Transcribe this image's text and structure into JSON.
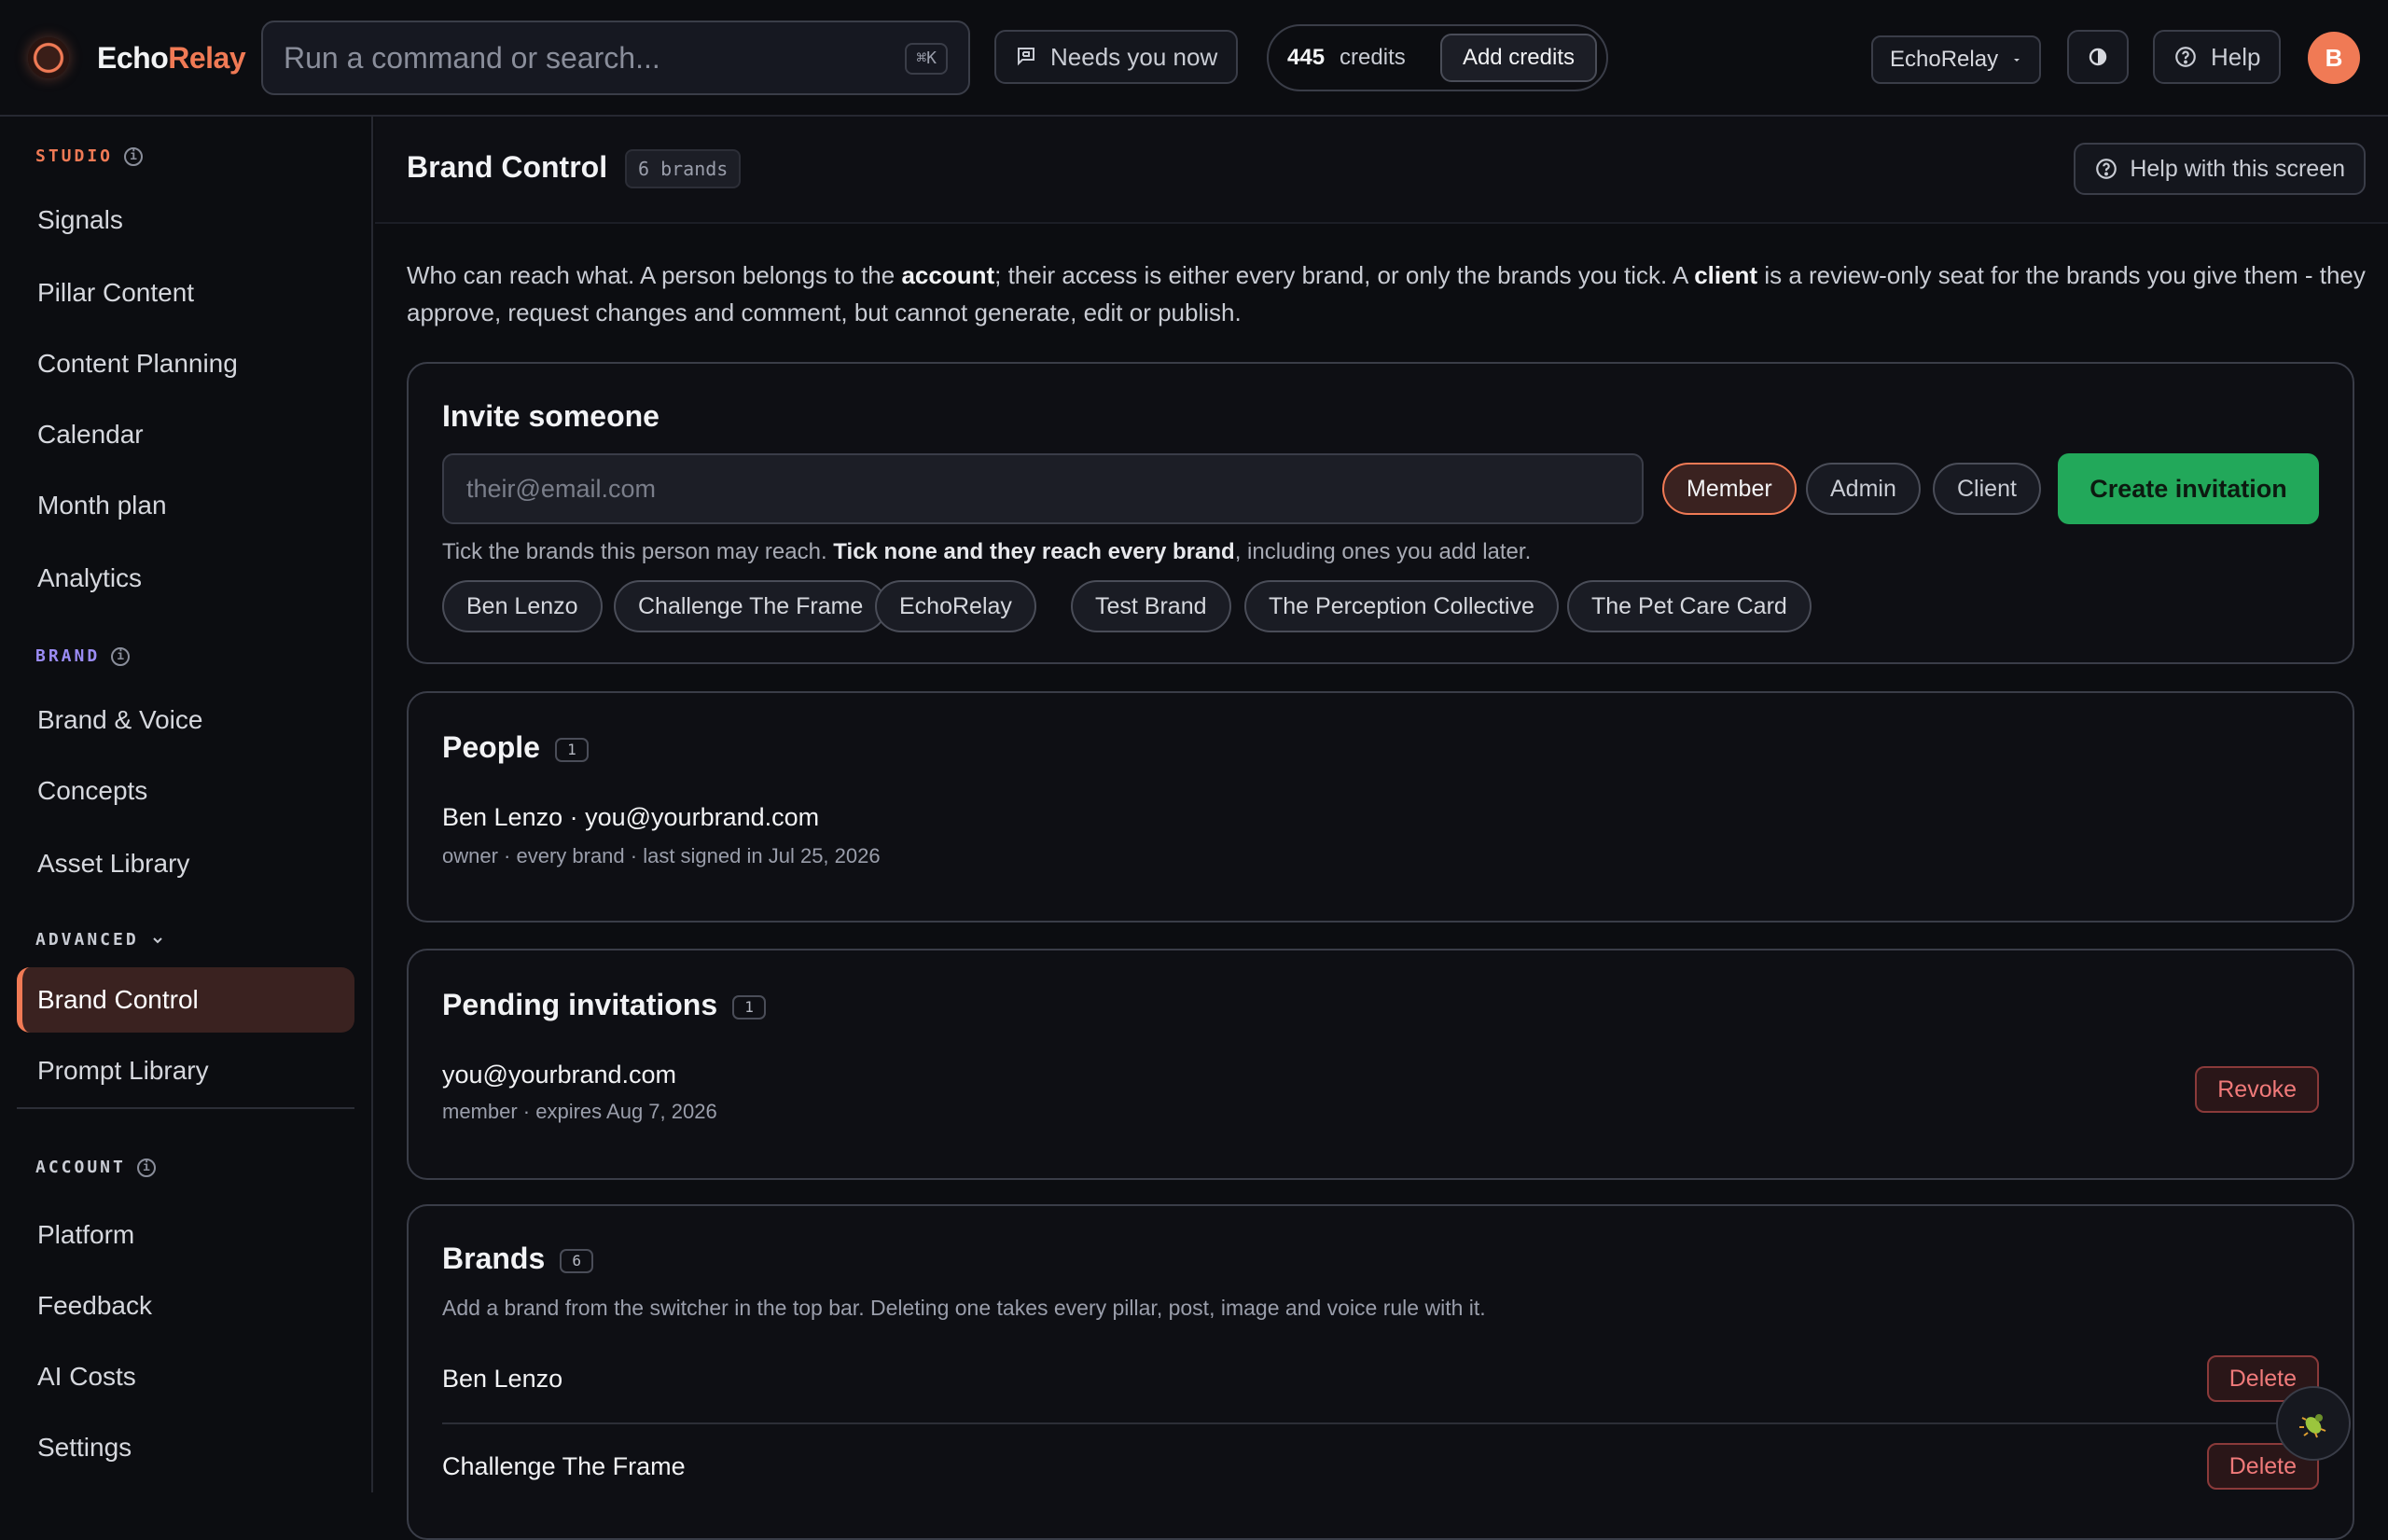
{
  "app": {
    "name_part1": "Echo",
    "name_part2": "Relay"
  },
  "topbar": {
    "search_placeholder": "Run a command or search...",
    "search_shortcut": "⌘K",
    "needs_label": "Needs you now",
    "credits_value": "445",
    "credits_label": "credits",
    "add_credits_label": "Add credits",
    "brand_switcher": "EchoRelay",
    "help_label": "Help",
    "avatar_initial": "B"
  },
  "sidebar": {
    "studio": {
      "title": "STUDIO",
      "color": "#f07a55",
      "items": [
        "Signals",
        "Pillar Content",
        "Content Planning",
        "Calendar",
        "Month plan",
        "Analytics"
      ]
    },
    "brand": {
      "title": "BRAND",
      "color": "#9b8cf5",
      "items": [
        "Brand & Voice",
        "Concepts",
        "Asset Library"
      ]
    },
    "advanced": {
      "title": "ADVANCED",
      "items": [
        "Brand Control",
        "Prompt Library"
      ],
      "active": "Brand Control"
    },
    "account": {
      "title": "ACCOUNT",
      "items": [
        "Platform",
        "Feedback",
        "AI Costs",
        "Settings"
      ]
    }
  },
  "page": {
    "title": "Brand Control",
    "brand_count": "6 brands",
    "help_label": "Help with this screen",
    "intro": {
      "p1": "Who can reach what. A person belongs to the ",
      "b1": "account",
      "p2": "; their access is either every brand, or only the brands you tick. A ",
      "b2": "client",
      "p3": " is a review-only seat for the brands you give them - they approve, request changes and comment, but cannot generate, edit or publish."
    }
  },
  "invite": {
    "title": "Invite someone",
    "email_placeholder": "their@email.com",
    "roles": [
      "Member",
      "Admin",
      "Client"
    ],
    "selected_role": "Member",
    "create_label": "Create invitation",
    "hint_p1": "Tick the brands this person may reach. ",
    "hint_b": "Tick none and they reach every brand",
    "hint_p2": ", including ones you add later.",
    "brands": [
      "Ben Lenzo",
      "Challenge The Frame",
      "EchoRelay",
      "Test Brand",
      "The Perception Collective",
      "The Pet Care Card"
    ]
  },
  "people": {
    "title": "People",
    "count": "1",
    "rows": [
      {
        "main": "Ben Lenzo · you@yourbrand.com",
        "sub": "owner · every brand · last signed in Jul 25, 2026"
      }
    ]
  },
  "pending": {
    "title": "Pending invitations",
    "count": "1",
    "rows": [
      {
        "main": "you@yourbrand.com",
        "sub": "member · expires Aug 7, 2026",
        "action": "Revoke"
      }
    ]
  },
  "brands": {
    "title": "Brands",
    "count": "6",
    "description": "Add a brand from the switcher in the top bar. Deleting one takes every pillar, post, image and voice rule with it.",
    "delete_label": "Delete",
    "rows": [
      "Ben Lenzo",
      "Challenge The Frame"
    ]
  }
}
